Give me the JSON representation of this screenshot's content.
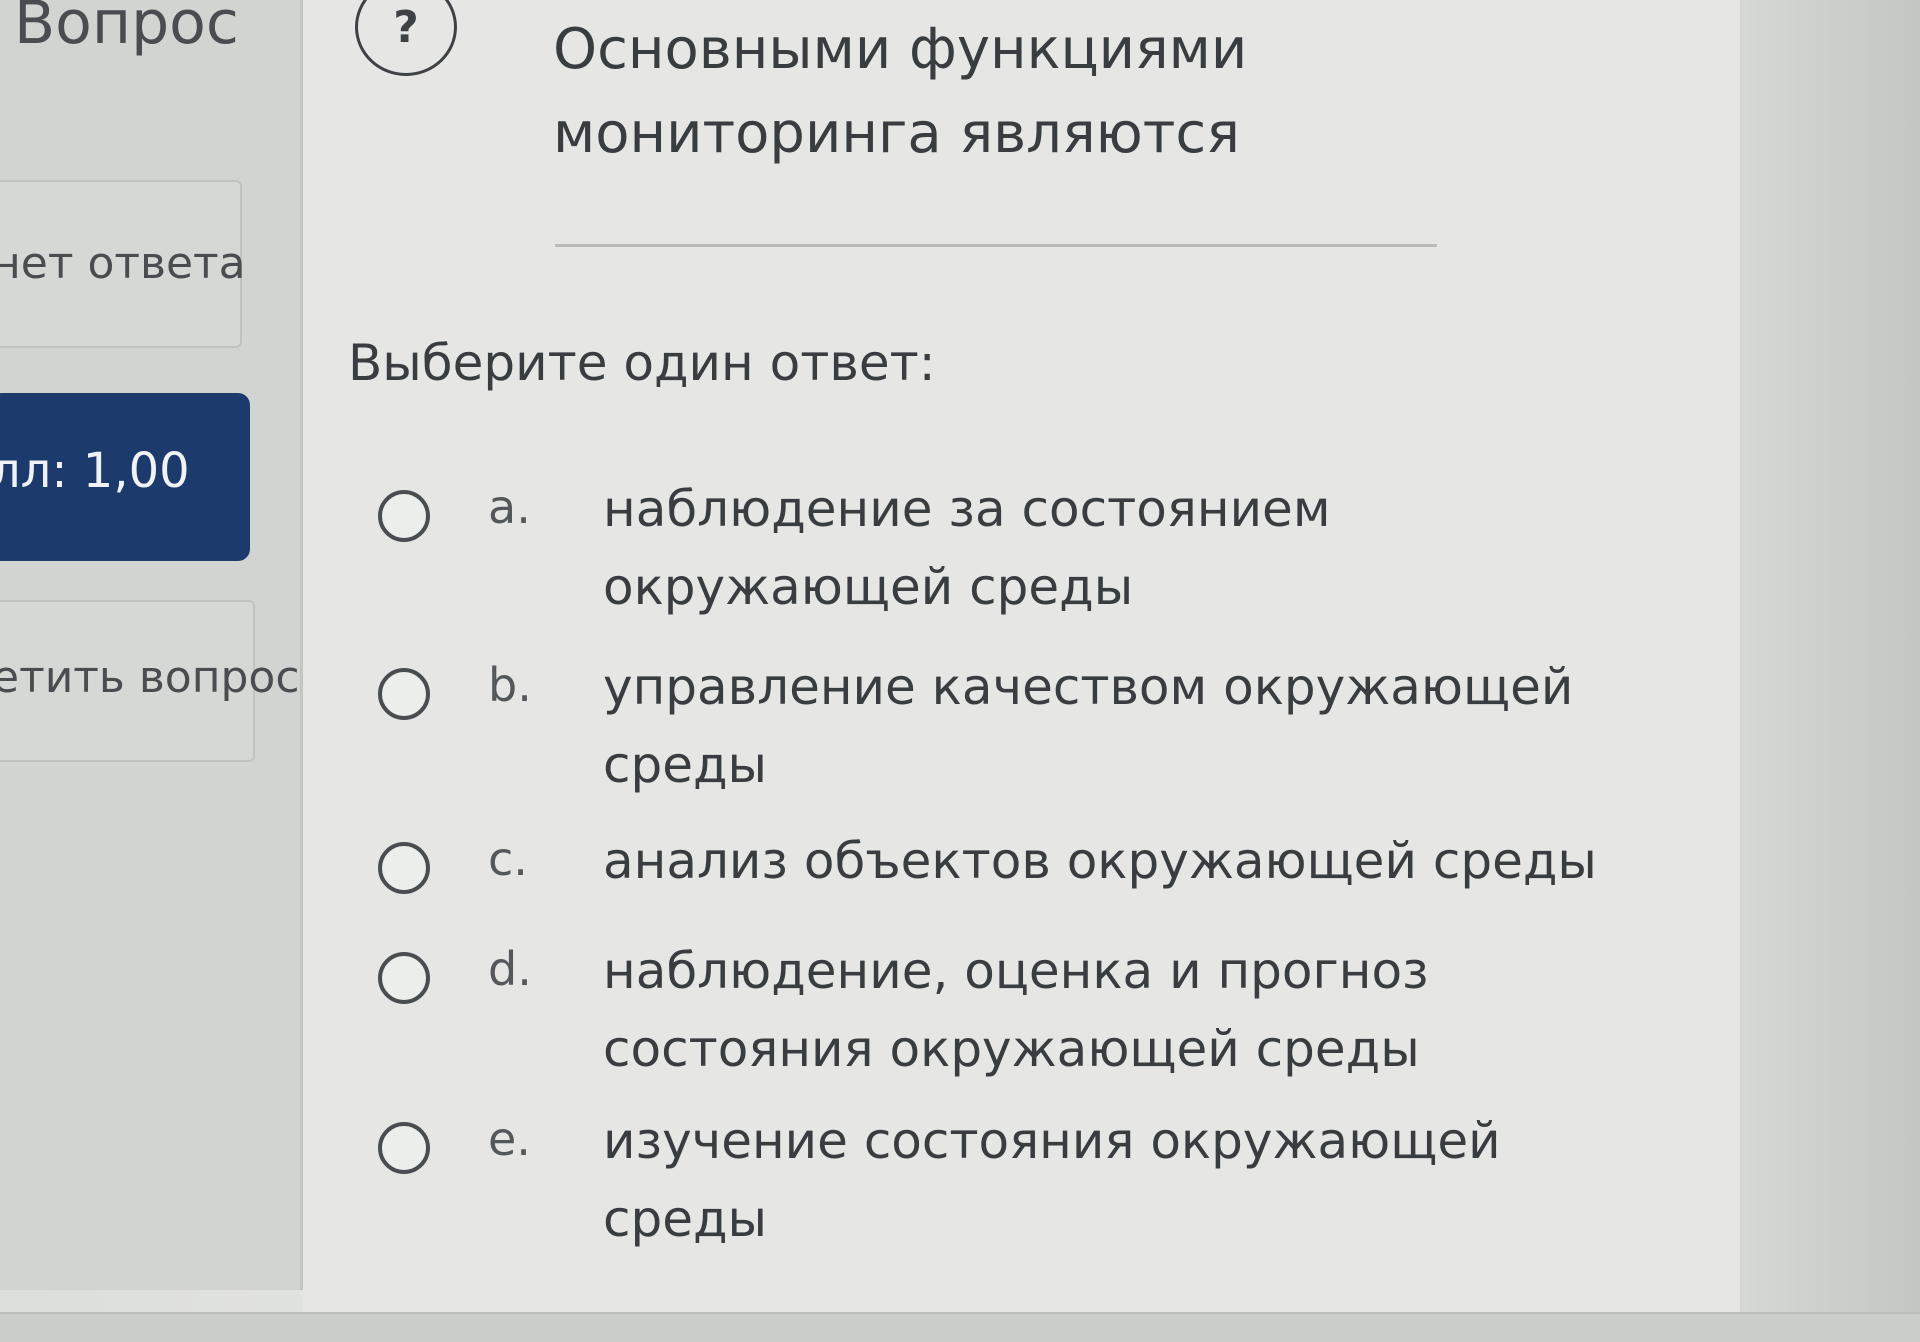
{
  "info": {
    "heading": "Вопрос",
    "state": "нет ответа",
    "grade": "лл: 1,00",
    "flag_label": "етить вопрос"
  },
  "question": {
    "help_glyph": "?",
    "text": "Основными функциями мониторинга являются",
    "prompt": "Выберите один ответ:"
  },
  "options": [
    {
      "letter": "a.",
      "text": "наблюдение за состоянием окружающей среды"
    },
    {
      "letter": "b.",
      "text": "управление качеством окружающей среды"
    },
    {
      "letter": "c.",
      "text": "анализ объектов окружающей среды"
    },
    {
      "letter": "d.",
      "text": "наблюдение, оценка и прогноз состояния окружающей среды"
    },
    {
      "letter": "e.",
      "text": "изучение состояния окружающей среды"
    }
  ]
}
